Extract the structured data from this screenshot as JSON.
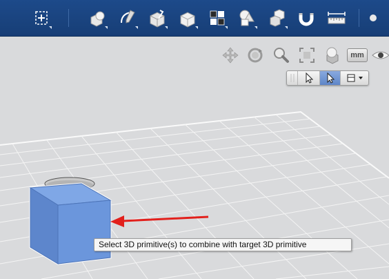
{
  "toolbar": {
    "buttons": [
      {
        "id": "transform",
        "icon": "transform-icon"
      },
      {
        "id": "primitives",
        "icon": "primitives-icon"
      },
      {
        "id": "sketch",
        "icon": "sketch-icon"
      },
      {
        "id": "construct",
        "icon": "construct-icon"
      },
      {
        "id": "modify",
        "icon": "modify-icon"
      },
      {
        "id": "pattern",
        "icon": "pattern-icon"
      },
      {
        "id": "grouping",
        "icon": "grouping-icon"
      },
      {
        "id": "combine",
        "icon": "combine-icon"
      },
      {
        "id": "snap",
        "icon": "snap-icon"
      },
      {
        "id": "measure",
        "icon": "measure-icon"
      }
    ]
  },
  "navbar": {
    "items": [
      "pan-icon",
      "orbit-icon",
      "zoom-icon",
      "fit-icon",
      "material-icon",
      "eye-icon"
    ],
    "units_label": "mm"
  },
  "selection_toolbar": {
    "items": [
      "select-icon",
      "select-active-icon",
      "selection-filter-icon"
    ]
  },
  "tooltip": {
    "text": "Select 3D primitive(s) to combine with target 3D primitive"
  },
  "colors": {
    "toolbar_bg": "#1d4a8a",
    "canvas_bg": "#d9dadc",
    "grid_line": "#ffffff",
    "box_fill": "#6d9ae0",
    "arrow": "#e2201c"
  }
}
